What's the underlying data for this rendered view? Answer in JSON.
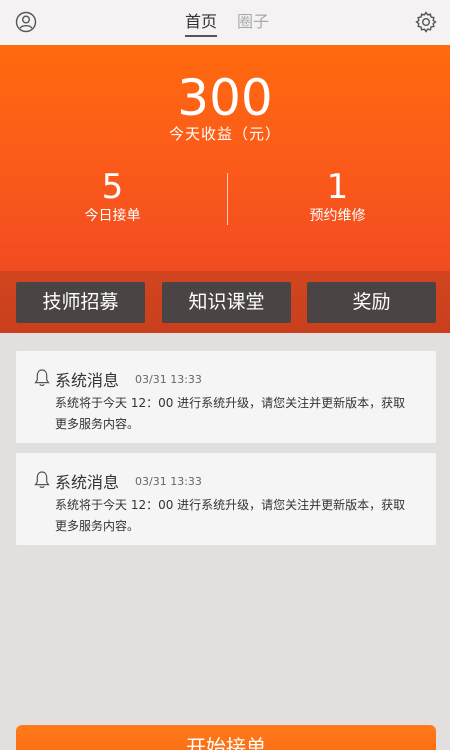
{
  "topbar": {
    "tabs": [
      {
        "label": "首页",
        "active": true
      },
      {
        "label": "圈子",
        "active": false
      }
    ],
    "left_icon": "user-icon",
    "right_icon": "gear-icon"
  },
  "summary": {
    "earnings_value": "300",
    "earnings_label": "今天收益（元）",
    "stats": [
      {
        "value": "5",
        "label": "今日接单"
      },
      {
        "value": "1",
        "label": "预约维修"
      }
    ]
  },
  "actions": [
    {
      "label": "技师招募"
    },
    {
      "label": "知识课堂"
    },
    {
      "label": "奖励"
    }
  ],
  "messages": [
    {
      "icon": "bell-icon",
      "title": "系统消息",
      "time": "03/31 13:33",
      "body": "系统将于今天 12：00 进行系统升级，请您关注并更新版本，获取更多服务内容。"
    },
    {
      "icon": "bell-icon",
      "title": "系统消息",
      "time": "03/31 13:33",
      "body": "系统将于今天 12：00 进行系统升级，请您关注并更新版本，获取更多服务内容。"
    }
  ],
  "start_button": {
    "label": "开始接单"
  },
  "colors": {
    "accent_orange": "#ff6a0e",
    "button_dark": "#4a4544",
    "background": "#e3dfdf"
  }
}
